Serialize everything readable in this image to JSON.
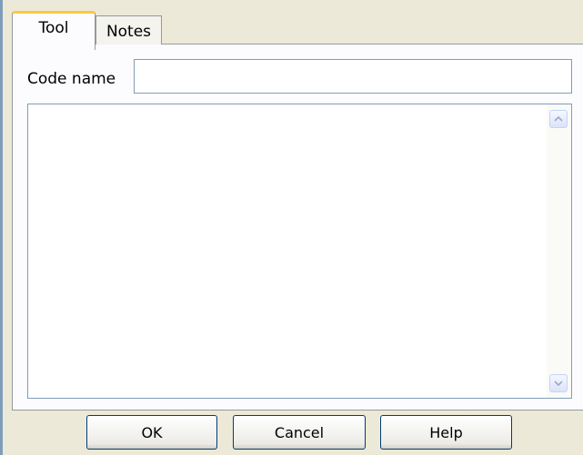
{
  "tabs": [
    {
      "label": "Tool",
      "active": true
    },
    {
      "label": "Notes",
      "active": false
    }
  ],
  "form": {
    "code_name_label": "Code name",
    "code_name_value": "",
    "notes_text": ""
  },
  "buttons": {
    "ok": "OK",
    "cancel": "Cancel",
    "help": "Help"
  },
  "icons": {
    "scroll_up": "chevron-up-icon",
    "scroll_down": "chevron-down-icon"
  },
  "colors": {
    "dialog_background": "#ece9d8",
    "panel_background": "#fcfcfe",
    "active_tab_accent": "#ffc83c",
    "field_border": "#7f9db9",
    "button_border": "#003c74"
  }
}
